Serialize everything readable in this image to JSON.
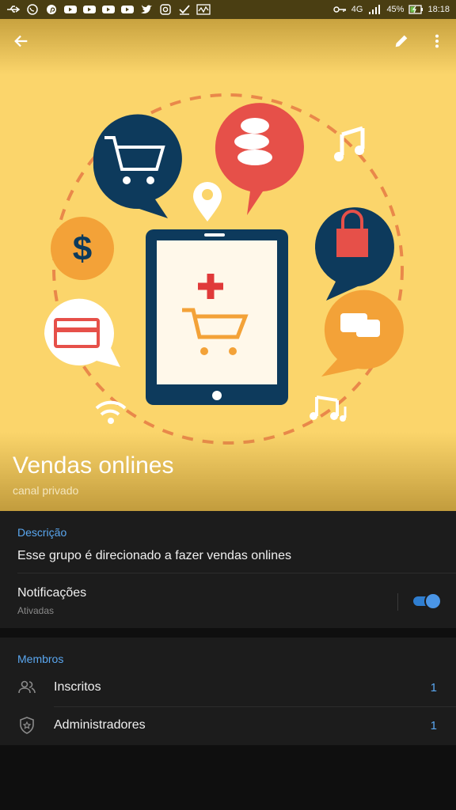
{
  "status_bar": {
    "left_icons": [
      "usb-icon",
      "whatsapp-icon",
      "pinterest-icon",
      "youtube-icon",
      "youtube-icon",
      "youtube-icon",
      "youtube-icon",
      "twitter-icon",
      "instagram-icon",
      "check-icon",
      "activity-icon"
    ],
    "network": "4G",
    "battery": "45%",
    "time": "18:18"
  },
  "appbar": {
    "back_icon": "arrow-left-icon",
    "edit_icon": "pencil-icon",
    "more_icon": "more-vert-icon"
  },
  "channel": {
    "title": "Vendas onlines",
    "subtitle": "canal privado"
  },
  "info": {
    "description_header": "Descrição",
    "description_text": "Esse grupo é direcionado a fazer vendas onlines",
    "notifications_label": "Notificações",
    "notifications_status": "Ativadas",
    "notifications_enabled": true
  },
  "members": {
    "header": "Membros",
    "rows": [
      {
        "label": "Inscritos",
        "count": "1",
        "icon": "people-icon"
      },
      {
        "label": "Administradores",
        "count": "1",
        "icon": "shield-star-icon"
      }
    ]
  },
  "colors": {
    "hero_bg": "#fbd56b",
    "accent": "#5aa7f0",
    "toggle_on": "#2f7ed0",
    "surface": "#1c1c1c"
  }
}
